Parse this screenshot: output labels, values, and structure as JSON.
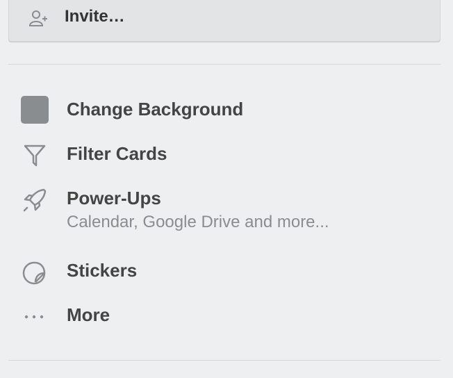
{
  "invite": {
    "label": "Invite…",
    "icon": "add-member-icon"
  },
  "menu": {
    "items": [
      {
        "label": "Change Background",
        "icon": "background-swatch-icon",
        "swatch_color": "#8a8d90"
      },
      {
        "label": "Filter Cards",
        "icon": "filter-icon"
      },
      {
        "label": "Power-Ups",
        "icon": "rocket-icon",
        "sub": "Calendar, Google Drive and more..."
      },
      {
        "label": "Stickers",
        "icon": "sticker-icon"
      },
      {
        "label": "More",
        "icon": "ellipsis-icon"
      }
    ]
  }
}
